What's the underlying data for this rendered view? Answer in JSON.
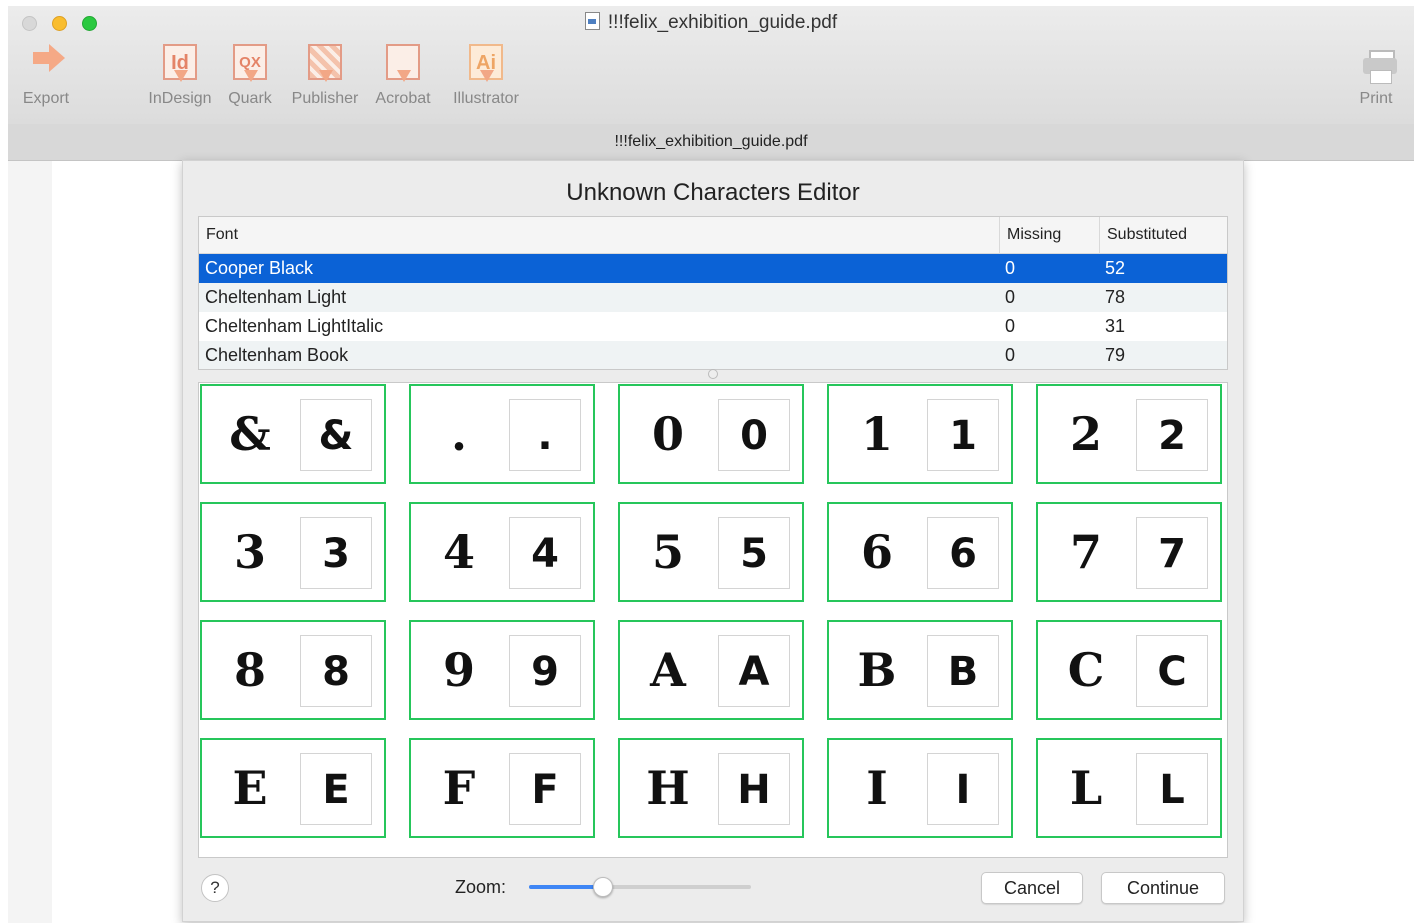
{
  "window": {
    "title": "!!!felix_exhibition_guide.pdf"
  },
  "toolbar": {
    "export_label": "Export",
    "print_label": "Print",
    "apps": [
      {
        "label": "InDesign",
        "icon_text": "Id"
      },
      {
        "label": "Quark",
        "icon_text": "QX"
      },
      {
        "label": "Publisher",
        "icon_text": ""
      },
      {
        "label": "Acrobat",
        "icon_text": ""
      },
      {
        "label": "Illustrator",
        "icon_text": "Ai"
      }
    ]
  },
  "document_tab": {
    "title": "!!!felix_exhibition_guide.pdf"
  },
  "dialog": {
    "title": "Unknown Characters Editor",
    "table": {
      "headers": [
        "Font",
        "Missing",
        "Substituted"
      ],
      "rows": [
        {
          "font": "Cooper Black",
          "missing": "0",
          "substituted": "52",
          "selected": true
        },
        {
          "font": "Cheltenham Light",
          "missing": "0",
          "substituted": "78"
        },
        {
          "font": "Cheltenham LightItalic",
          "missing": "0",
          "substituted": "31"
        },
        {
          "font": "Cheltenham Book",
          "missing": "0",
          "substituted": "79"
        }
      ]
    },
    "glyphs": [
      "&",
      ".",
      "0",
      "1",
      "2",
      "3",
      "4",
      "5",
      "6",
      "7",
      "8",
      "9",
      "A",
      "B",
      "C",
      "E",
      "F",
      "H",
      "I",
      "L"
    ],
    "help_label": "?",
    "zoom_label": "Zoom:",
    "zoom_level": 0.33,
    "cancel_label": "Cancel",
    "continue_label": "Continue"
  },
  "colors": {
    "selection": "#0b62d6",
    "glyph_border": "#26c65b",
    "slider_fill": "#3f86f5",
    "app_icon": "#e48367"
  }
}
